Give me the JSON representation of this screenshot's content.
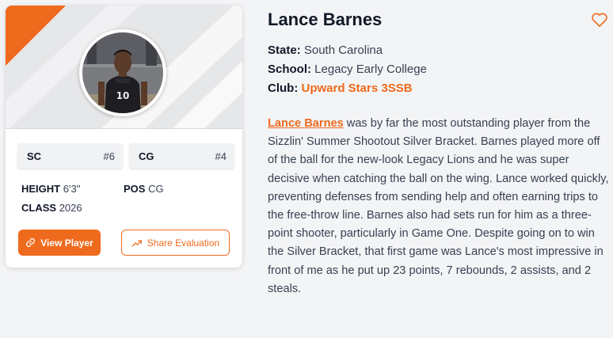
{
  "player": {
    "name": "Lance Barnes",
    "state_label": "State:",
    "state": "South Carolina",
    "school_label": "School:",
    "school": "Legacy Early College",
    "club_label": "Club:",
    "club": "Upward Stars 3SSB"
  },
  "card": {
    "rank_state": {
      "label": "SC",
      "value": "#6"
    },
    "rank_pos": {
      "label": "CG",
      "value": "#4"
    },
    "height_label": "HEIGHT",
    "height": "6'3\"",
    "pos_label": "POS",
    "pos": "CG",
    "class_label": "CLASS",
    "class": "2026",
    "jersey": "10",
    "view_label": "View Player",
    "share_label": "Share Evaluation"
  },
  "bio": {
    "link_text": "Lance Barnes",
    "text": " was by far the most outstanding player from the Sizzlin' Summer Shootout Silver Bracket. Barnes played more off of the ball for the new-look Legacy Lions and he was super decisive when catching the ball on the wing. Lance worked quickly, preventing defenses from sending help and often earning trips to the free-throw line. Barnes also had sets run for him as a three-point shooter, particularly in Game One. Despite going on to win the Silver Bracket, that first game was Lance's most impressive in front of me as he put up 23 points, 7 rebounds, 2 assists, and 2 steals."
  },
  "colors": {
    "accent": "#ee6a1d"
  },
  "icons": {
    "favorite": "heart-icon",
    "view": "link-icon",
    "share": "trend-up-icon"
  }
}
